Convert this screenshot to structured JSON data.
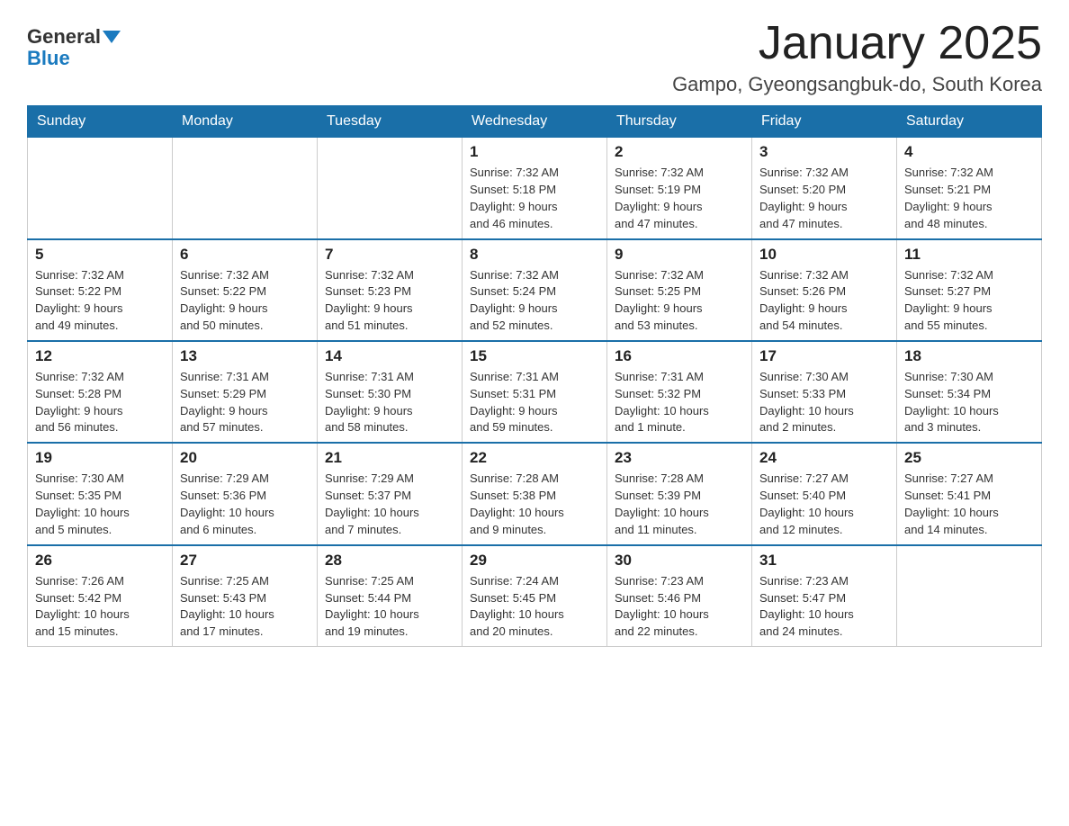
{
  "header": {
    "logo_text_general": "General",
    "logo_text_blue": "Blue",
    "month_title": "January 2025",
    "location": "Gampo, Gyeongsangbuk-do, South Korea"
  },
  "weekdays": [
    "Sunday",
    "Monday",
    "Tuesday",
    "Wednesday",
    "Thursday",
    "Friday",
    "Saturday"
  ],
  "weeks": [
    [
      {
        "day": "",
        "info": ""
      },
      {
        "day": "",
        "info": ""
      },
      {
        "day": "",
        "info": ""
      },
      {
        "day": "1",
        "info": "Sunrise: 7:32 AM\nSunset: 5:18 PM\nDaylight: 9 hours\nand 46 minutes."
      },
      {
        "day": "2",
        "info": "Sunrise: 7:32 AM\nSunset: 5:19 PM\nDaylight: 9 hours\nand 47 minutes."
      },
      {
        "day": "3",
        "info": "Sunrise: 7:32 AM\nSunset: 5:20 PM\nDaylight: 9 hours\nand 47 minutes."
      },
      {
        "day": "4",
        "info": "Sunrise: 7:32 AM\nSunset: 5:21 PM\nDaylight: 9 hours\nand 48 minutes."
      }
    ],
    [
      {
        "day": "5",
        "info": "Sunrise: 7:32 AM\nSunset: 5:22 PM\nDaylight: 9 hours\nand 49 minutes."
      },
      {
        "day": "6",
        "info": "Sunrise: 7:32 AM\nSunset: 5:22 PM\nDaylight: 9 hours\nand 50 minutes."
      },
      {
        "day": "7",
        "info": "Sunrise: 7:32 AM\nSunset: 5:23 PM\nDaylight: 9 hours\nand 51 minutes."
      },
      {
        "day": "8",
        "info": "Sunrise: 7:32 AM\nSunset: 5:24 PM\nDaylight: 9 hours\nand 52 minutes."
      },
      {
        "day": "9",
        "info": "Sunrise: 7:32 AM\nSunset: 5:25 PM\nDaylight: 9 hours\nand 53 minutes."
      },
      {
        "day": "10",
        "info": "Sunrise: 7:32 AM\nSunset: 5:26 PM\nDaylight: 9 hours\nand 54 minutes."
      },
      {
        "day": "11",
        "info": "Sunrise: 7:32 AM\nSunset: 5:27 PM\nDaylight: 9 hours\nand 55 minutes."
      }
    ],
    [
      {
        "day": "12",
        "info": "Sunrise: 7:32 AM\nSunset: 5:28 PM\nDaylight: 9 hours\nand 56 minutes."
      },
      {
        "day": "13",
        "info": "Sunrise: 7:31 AM\nSunset: 5:29 PM\nDaylight: 9 hours\nand 57 minutes."
      },
      {
        "day": "14",
        "info": "Sunrise: 7:31 AM\nSunset: 5:30 PM\nDaylight: 9 hours\nand 58 minutes."
      },
      {
        "day": "15",
        "info": "Sunrise: 7:31 AM\nSunset: 5:31 PM\nDaylight: 9 hours\nand 59 minutes."
      },
      {
        "day": "16",
        "info": "Sunrise: 7:31 AM\nSunset: 5:32 PM\nDaylight: 10 hours\nand 1 minute."
      },
      {
        "day": "17",
        "info": "Sunrise: 7:30 AM\nSunset: 5:33 PM\nDaylight: 10 hours\nand 2 minutes."
      },
      {
        "day": "18",
        "info": "Sunrise: 7:30 AM\nSunset: 5:34 PM\nDaylight: 10 hours\nand 3 minutes."
      }
    ],
    [
      {
        "day": "19",
        "info": "Sunrise: 7:30 AM\nSunset: 5:35 PM\nDaylight: 10 hours\nand 5 minutes."
      },
      {
        "day": "20",
        "info": "Sunrise: 7:29 AM\nSunset: 5:36 PM\nDaylight: 10 hours\nand 6 minutes."
      },
      {
        "day": "21",
        "info": "Sunrise: 7:29 AM\nSunset: 5:37 PM\nDaylight: 10 hours\nand 7 minutes."
      },
      {
        "day": "22",
        "info": "Sunrise: 7:28 AM\nSunset: 5:38 PM\nDaylight: 10 hours\nand 9 minutes."
      },
      {
        "day": "23",
        "info": "Sunrise: 7:28 AM\nSunset: 5:39 PM\nDaylight: 10 hours\nand 11 minutes."
      },
      {
        "day": "24",
        "info": "Sunrise: 7:27 AM\nSunset: 5:40 PM\nDaylight: 10 hours\nand 12 minutes."
      },
      {
        "day": "25",
        "info": "Sunrise: 7:27 AM\nSunset: 5:41 PM\nDaylight: 10 hours\nand 14 minutes."
      }
    ],
    [
      {
        "day": "26",
        "info": "Sunrise: 7:26 AM\nSunset: 5:42 PM\nDaylight: 10 hours\nand 15 minutes."
      },
      {
        "day": "27",
        "info": "Sunrise: 7:25 AM\nSunset: 5:43 PM\nDaylight: 10 hours\nand 17 minutes."
      },
      {
        "day": "28",
        "info": "Sunrise: 7:25 AM\nSunset: 5:44 PM\nDaylight: 10 hours\nand 19 minutes."
      },
      {
        "day": "29",
        "info": "Sunrise: 7:24 AM\nSunset: 5:45 PM\nDaylight: 10 hours\nand 20 minutes."
      },
      {
        "day": "30",
        "info": "Sunrise: 7:23 AM\nSunset: 5:46 PM\nDaylight: 10 hours\nand 22 minutes."
      },
      {
        "day": "31",
        "info": "Sunrise: 7:23 AM\nSunset: 5:47 PM\nDaylight: 10 hours\nand 24 minutes."
      },
      {
        "day": "",
        "info": ""
      }
    ]
  ]
}
